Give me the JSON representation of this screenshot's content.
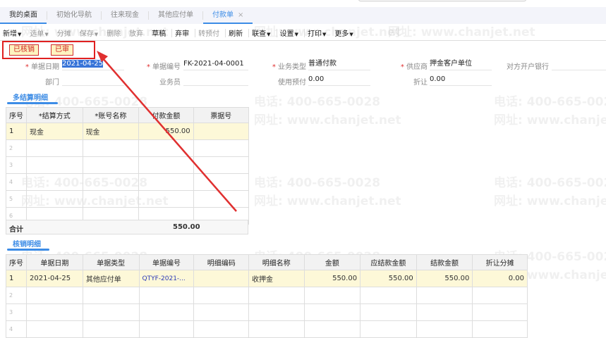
{
  "tabs": [
    {
      "label": "我的桌面"
    },
    {
      "label": "初始化导航"
    },
    {
      "label": "往来现金"
    },
    {
      "label": "其他应付单"
    },
    {
      "label": "付款单",
      "close": "×"
    }
  ],
  "toolbar": [
    {
      "label": "新增",
      "dd": true
    },
    {
      "label": "选单",
      "dd": true,
      "dis": true
    },
    {
      "label": "分摊",
      "dis": true
    },
    {
      "label": "保存",
      "dd": true,
      "dis": true
    },
    {
      "label": "删除",
      "dis": true
    },
    {
      "label": "放弃",
      "dis": true
    },
    {
      "label": "草稿"
    },
    {
      "label": "弃审"
    },
    {
      "label": "转预付",
      "dis": true
    },
    {
      "label": "刷新"
    },
    {
      "label": "联查",
      "dd": true
    },
    {
      "label": "设置",
      "dd": true
    },
    {
      "label": "打印",
      "dd": true
    },
    {
      "label": "更多",
      "dd": true
    }
  ],
  "badges": {
    "verified": "已核销",
    "audited": "已审"
  },
  "form": {
    "date_label": "单据日期",
    "date": "2021-04-25",
    "no_label": "单据编号",
    "no": "FK-2021-04-0001",
    "type_label": "业务类型",
    "type": "普通付款",
    "supplier_label": "供应商",
    "supplier": "押金客户单位",
    "bank_label": "对方开户银行",
    "dept_label": "部门",
    "staff_label": "业务员",
    "prepay_label": "使用预付",
    "prepay": "0.00",
    "discount_label": "折让",
    "discount": "0.00",
    "required": "*"
  },
  "settle": {
    "title": "多结算明细",
    "headers": [
      "序号",
      "*结算方式",
      "*账号名称",
      "付款金额",
      "票据号"
    ],
    "rows": [
      [
        "1",
        "现金",
        "现金",
        "550.00",
        ""
      ],
      [
        "2",
        "",
        "",
        "",
        ""
      ],
      [
        "3",
        "",
        "",
        "",
        ""
      ],
      [
        "4",
        "",
        "",
        "",
        ""
      ],
      [
        "5",
        "",
        "",
        "",
        ""
      ],
      [
        "6",
        "",
        "",
        "",
        ""
      ]
    ],
    "total_label": "合计",
    "total": "550.00"
  },
  "writeoff": {
    "title": "核销明细",
    "headers": [
      "序号",
      "单据日期",
      "单据类型",
      "单据编号",
      "明细编码",
      "明细名称",
      "金额",
      "应结款金额",
      "结款金额",
      "折让分摊"
    ],
    "rows": [
      [
        "1",
        "2021-04-25",
        "其他应付单",
        "QTYF-2021-...",
        "",
        "收押金",
        "550.00",
        "550.00",
        "550.00",
        "0.00"
      ],
      [
        "2",
        "",
        "",
        "",
        "",
        "",
        "",
        "",
        "",
        ""
      ],
      [
        "3",
        "",
        "",
        "",
        "",
        "",
        "",
        "",
        "",
        ""
      ],
      [
        "4",
        "",
        "",
        "",
        "",
        "",
        "",
        "",
        "",
        ""
      ]
    ]
  },
  "watermark": {
    "phone": "电话: 400-665-0028",
    "site": "网址: www.chanjet.net"
  },
  "colors": {
    "accent": "#3c8ce6",
    "annotation": "#e02020"
  }
}
